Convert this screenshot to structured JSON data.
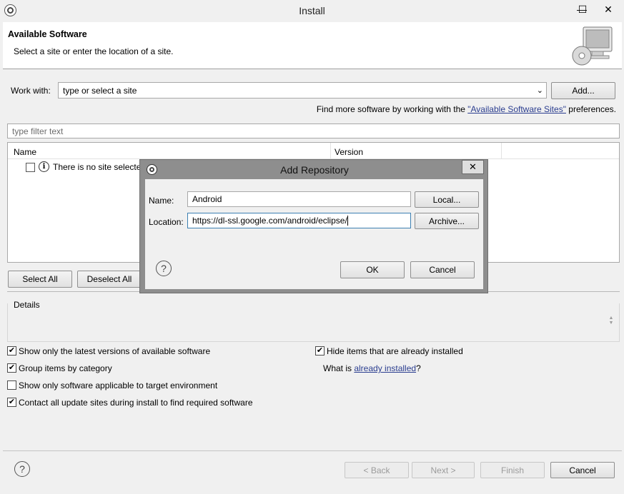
{
  "window": {
    "title": "Install",
    "minimize_glyph": "—",
    "maximize_glyph": "☐",
    "close_glyph": "✕"
  },
  "header": {
    "title": "Available Software",
    "subtitle": "Select a site or enter the location of a site."
  },
  "work_with": {
    "label": "Work with:",
    "value": "type or select a site",
    "add_label": "Add..."
  },
  "find_more": {
    "prefix": "Find more software by working with the ",
    "link": "\"Available Software Sites\"",
    "suffix": " preferences."
  },
  "filter": {
    "placeholder": "type filter text"
  },
  "table": {
    "columns": [
      "Name",
      "Version"
    ],
    "rows": [
      {
        "name": "There is no site selected."
      }
    ]
  },
  "selection": {
    "select_all": "Select All",
    "deselect_all": "Deselect All"
  },
  "details": {
    "label": "Details"
  },
  "options": {
    "show_latest": {
      "label": "Show only the latest versions of available software",
      "checked": true
    },
    "group_by_category": {
      "label": "Group items by category",
      "checked": true
    },
    "applicable_only": {
      "label": "Show only software applicable to target environment",
      "checked": false
    },
    "contact_all": {
      "label": "Contact all update sites during install to find required software",
      "checked": true
    },
    "hide_installed": {
      "label": "Hide items that are already installed",
      "checked": true
    },
    "what_is_prefix": "What is ",
    "what_is_link": "already installed",
    "what_is_suffix": "?"
  },
  "footer": {
    "back": "< Back",
    "next": "Next >",
    "finish": "Finish",
    "cancel": "Cancel"
  },
  "dialog": {
    "title": "Add Repository",
    "name_label": "Name:",
    "name_value": "Android",
    "local_label": "Local...",
    "location_label": "Location:",
    "location_value": "https://dl-ssl.google.com/android/eclipse/",
    "archive_label": "Archive...",
    "ok_label": "OK",
    "cancel_label": "Cancel",
    "close_glyph": "✕"
  },
  "icons": {
    "check_glyph": "✔",
    "help_glyph": "?",
    "info_glyph": "i",
    "chevron": "⌄"
  }
}
